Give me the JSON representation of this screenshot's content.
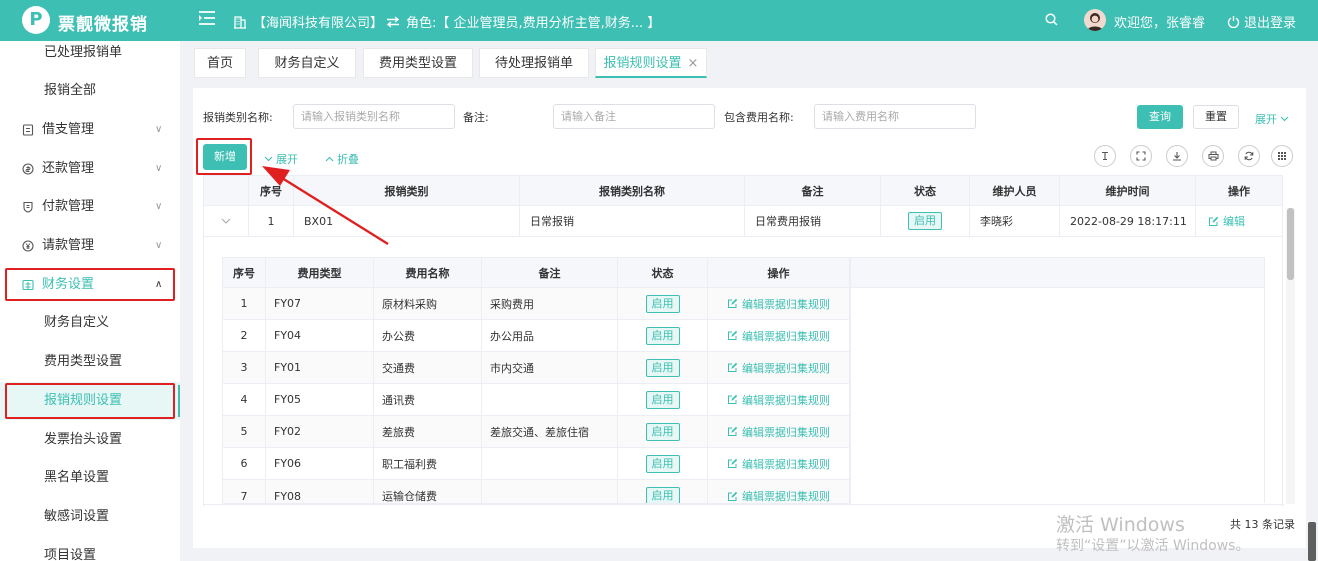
{
  "header": {
    "logo_letter": "P",
    "app_name": "票靓微报销",
    "company": "【海闻科技有限公司】",
    "role": "角色:【 企业管理员,费用分析主管,财务... 】",
    "welcome": "欢迎您，张睿睿",
    "logout": "退出登录"
  },
  "sidebar": {
    "items": [
      {
        "label": "已处理报销单"
      },
      {
        "label": "报销全部"
      },
      {
        "label": "借支管理"
      },
      {
        "label": "还款管理"
      },
      {
        "label": "付款管理"
      },
      {
        "label": "请款管理"
      },
      {
        "label": "财务设置"
      },
      {
        "label": "财务自定义"
      },
      {
        "label": "费用类型设置"
      },
      {
        "label": "报销规则设置"
      },
      {
        "label": "发票抬头设置"
      },
      {
        "label": "黑名单设置"
      },
      {
        "label": "敏感词设置"
      },
      {
        "label": "项目设置"
      }
    ]
  },
  "tabs": [
    {
      "label": "首页"
    },
    {
      "label": "财务自定义"
    },
    {
      "label": "费用类型设置"
    },
    {
      "label": "待处理报销单"
    },
    {
      "label": "报销规则设置"
    }
  ],
  "filters": {
    "category_label": "报销类别名称:",
    "category_placeholder": "请输入报销类别名称",
    "remark_label": "备注:",
    "remark_placeholder": "请输入备注",
    "fee_label": "包含费用名称:",
    "fee_placeholder": "请输入费用名称",
    "query": "查询",
    "reset": "重置",
    "expand": "展开"
  },
  "toolbar": {
    "add": "新增",
    "expand": "展开",
    "collapse": "折叠"
  },
  "main_table": {
    "headers": [
      "序号",
      "报销类别",
      "报销类别名称",
      "备注",
      "状态",
      "维护人员",
      "维护时间",
      "操作"
    ],
    "row": {
      "index": "1",
      "code": "BX01",
      "name": "日常报销",
      "remark": "日常费用报销",
      "status": "启用",
      "maintainer": "李晓彩",
      "time": "2022-08-29 18:17:11",
      "action": "编辑"
    }
  },
  "sub_table": {
    "headers": [
      "序号",
      "费用类型",
      "费用名称",
      "备注",
      "状态",
      "操作"
    ],
    "rows": [
      {
        "index": "1",
        "type": "FY07",
        "name": "原材料采购",
        "remark": "采购费用",
        "status": "启用",
        "action": "编辑票据归集规则"
      },
      {
        "index": "2",
        "type": "FY04",
        "name": "办公费",
        "remark": "办公用品",
        "status": "启用",
        "action": "编辑票据归集规则"
      },
      {
        "index": "3",
        "type": "FY01",
        "name": "交通费",
        "remark": "市内交通",
        "status": "启用",
        "action": "编辑票据归集规则"
      },
      {
        "index": "4",
        "type": "FY05",
        "name": "通讯费",
        "remark": "",
        "status": "启用",
        "action": "编辑票据归集规则"
      },
      {
        "index": "5",
        "type": "FY02",
        "name": "差旅费",
        "remark": "差旅交通、差旅住宿",
        "status": "启用",
        "action": "编辑票据归集规则"
      },
      {
        "index": "6",
        "type": "FY06",
        "name": "职工福利费",
        "remark": "",
        "status": "启用",
        "action": "编辑票据归集规则"
      },
      {
        "index": "7",
        "type": "FY08",
        "name": "运输仓储费",
        "remark": "",
        "status": "启用",
        "action": "编辑票据归集规则"
      }
    ]
  },
  "footer": {
    "total": "共 13 条记录",
    "watermark_title": "激活 Windows",
    "watermark_sub": "转到“设置”以激活 Windows。"
  },
  "colors": {
    "accent": "#3dbfb3",
    "highlight": "#e02020"
  }
}
